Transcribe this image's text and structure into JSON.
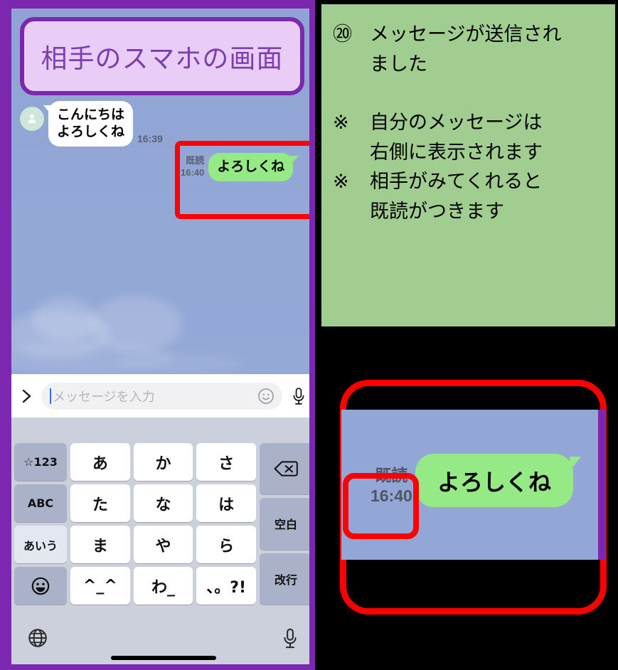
{
  "phone": {
    "banner_label": "相手のスマホの画面",
    "messages": [
      {
        "direction": "incoming",
        "avatar_icon": "person-icon",
        "text": "こんにちは\nよろしくね",
        "time": "16:39"
      },
      {
        "direction": "outgoing",
        "read_label": "既読",
        "time": "16:40",
        "text": "よろしくね"
      }
    ],
    "input": {
      "expand_icon": "chevron-right-icon",
      "placeholder": "メッセージを入力",
      "value": "",
      "emoji_icon": "smiley-icon",
      "mic_icon": "microphone-icon"
    },
    "keyboard": {
      "row1": [
        "☆123",
        "あ",
        "か",
        "さ"
      ],
      "delete_label": "delete-icon",
      "row2": [
        "ABC",
        "た",
        "な",
        "は"
      ],
      "space_label": "空白",
      "row3": [
        "あいう",
        "ま",
        "や",
        "ら"
      ],
      "return_label": "改行",
      "row4": [
        "emoji-icon",
        "^_^",
        "わ_",
        "、。?!"
      ],
      "globe_icon": "globe-icon",
      "dictation_icon": "microphone-icon"
    }
  },
  "note": {
    "step_number": "⑳",
    "step_text_line1": "メッセージが送信され",
    "step_text_line2": "ました",
    "notes": [
      {
        "marker": "※",
        "line1": "自分のメッセージは",
        "line2": "右側に表示されます"
      },
      {
        "marker": "※",
        "line1": "相手がみてくれると",
        "line2": "既読がつきます"
      }
    ]
  },
  "detail": {
    "read_label": "既読",
    "time": "16:40",
    "bubble_text": "よろしくね"
  },
  "colors": {
    "phone_frame": "#7b27b0",
    "banner_fill": "#e9cdf7",
    "banner_text": "#7b3fae",
    "chat_background": "#93a7d6",
    "outgoing_bubble": "#96ea85",
    "incoming_bubble": "#ffffff",
    "note_background": "#a2cd91",
    "highlight": "#ff0000",
    "keyboard_background": "#ccd0dc",
    "key_function": "#a9b2c8"
  }
}
